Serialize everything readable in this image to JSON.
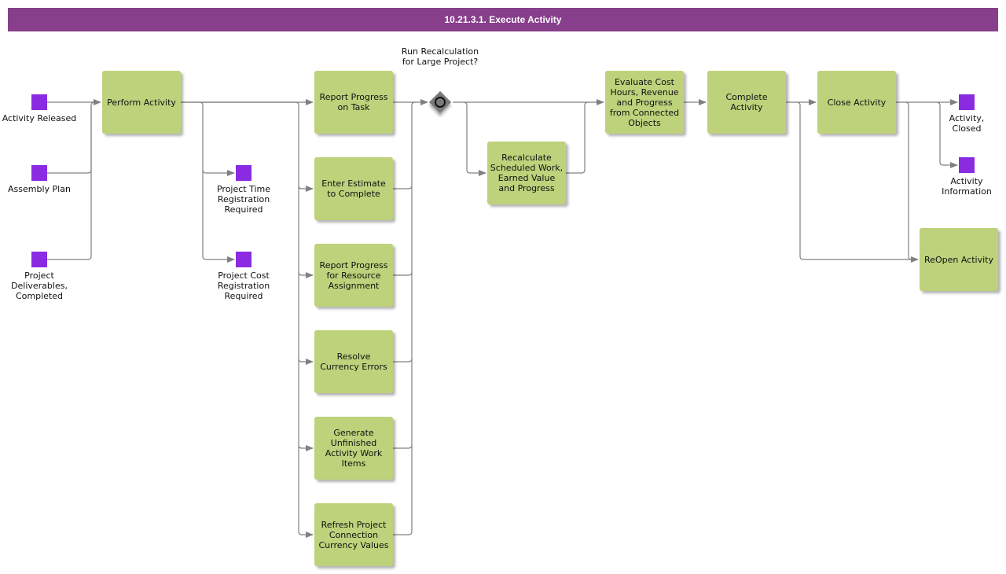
{
  "title": "10.21.3.1. Execute Activity",
  "colors": {
    "title_bar": "#873e8b",
    "task_fill": "#bdd27b",
    "event_fill": "#8a2be2",
    "gateway_fill": "#7a7a7a",
    "connector": "#808080"
  },
  "events": {
    "activity_released": "Activity Released",
    "assembly_plan": "Assembly Plan",
    "project_deliverables_completed": "Project Deliverables, Completed",
    "project_time_registration_required": "Project Time Registration Required",
    "project_cost_registration_required": "Project Cost Registration Required",
    "activity_closed": "Activity, Closed",
    "activity_information": "Activity Information"
  },
  "tasks": {
    "perform_activity": "Perform Activity",
    "report_progress_on_task": "Report Progress on Task",
    "enter_estimate_to_complete": "Enter Estimate to Complete",
    "report_progress_resource_assignment": "Report Progress for Resource Assignment",
    "resolve_currency_errors": "Resolve Currency Errors",
    "generate_unfinished_work_items": "Generate Unfinished Activity Work Items",
    "refresh_project_connection": "Refresh Project Connection Currency Values",
    "recalculate_scheduled_work": "Recalculate Scheduled Work, Earned Value and Progress",
    "evaluate_cost_hours": "Evaluate Cost Hours, Revenue and Progress from Connected Objects",
    "complete_activity": "Complete Activity",
    "close_activity": "Close Activity",
    "reopen_activity": "ReOpen Activity"
  },
  "gateways": {
    "run_recalculation": "Run Recalculation for Large Project?"
  }
}
